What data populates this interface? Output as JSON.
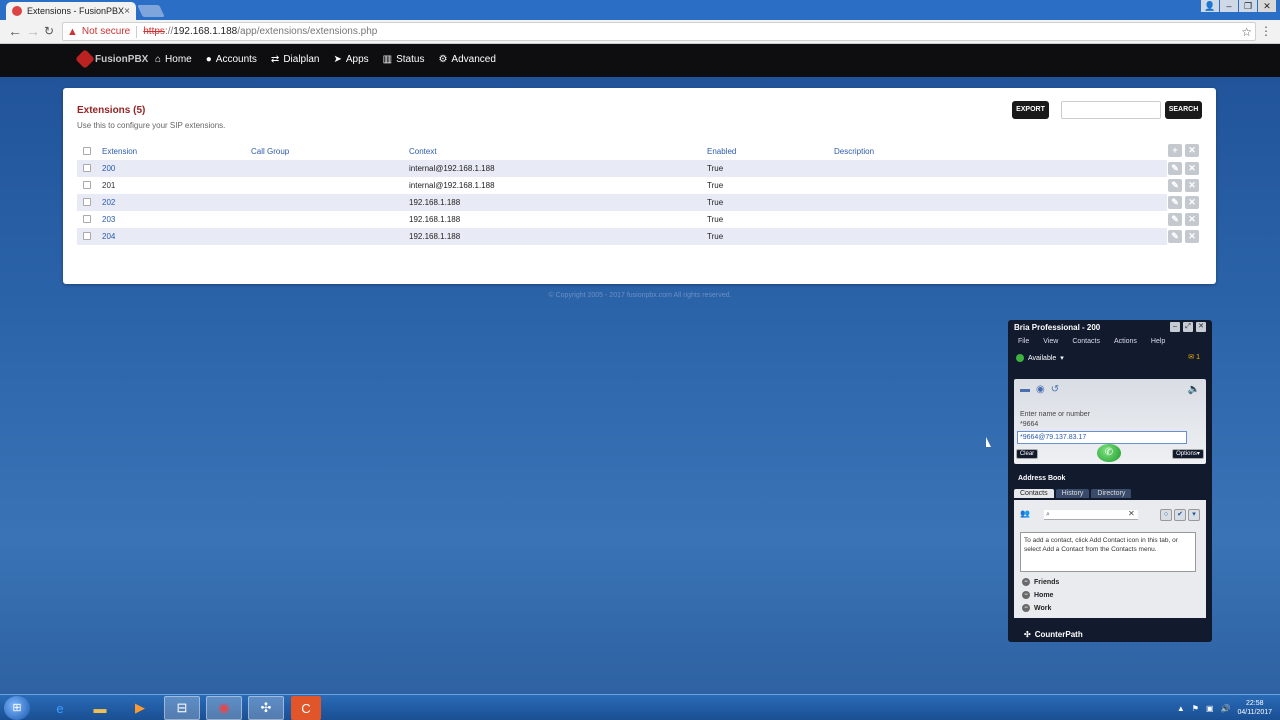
{
  "browser": {
    "tab_title": "Extensions - FusionPBX",
    "tab_close": "×",
    "not_secure": "Not secure",
    "url_scheme": "https",
    "url_sep": "://",
    "url_host": "192.168.1.188",
    "url_path": "/app/extensions/extensions.php"
  },
  "nav": {
    "logo_text": "FusionPBX",
    "items": [
      {
        "label": "Home",
        "icon": "home-icon"
      },
      {
        "label": "Accounts",
        "icon": "user-icon"
      },
      {
        "label": "Dialplan",
        "icon": "arrows-icon"
      },
      {
        "label": "Apps",
        "icon": "plane-icon"
      },
      {
        "label": "Status",
        "icon": "chart-icon"
      },
      {
        "label": "Advanced",
        "icon": "gear-icon"
      }
    ]
  },
  "page": {
    "title": "Extensions (5)",
    "subtitle": "Use this to configure your SIP extensions.",
    "export_label": "EXPORT",
    "search_label": "SEARCH",
    "search_value": "",
    "columns": [
      "Extension",
      "Call Group",
      "Context",
      "Enabled",
      "Description"
    ],
    "rows": [
      {
        "extension": "200",
        "call_group": "",
        "context": "internal@192.168.1.188",
        "enabled": "True",
        "description": ""
      },
      {
        "extension": "201",
        "call_group": "",
        "context": "internal@192.168.1.188",
        "enabled": "True",
        "description": ""
      },
      {
        "extension": "202",
        "call_group": "",
        "context": "192.168.1.188",
        "enabled": "True",
        "description": ""
      },
      {
        "extension": "203",
        "call_group": "",
        "context": "192.168.1.188",
        "enabled": "True",
        "description": ""
      },
      {
        "extension": "204",
        "call_group": "",
        "context": "192.168.1.188",
        "enabled": "True",
        "description": ""
      }
    ],
    "copyright": "© Copyright 2005 - 2017 fusionpbx.com All rights reserved."
  },
  "bria": {
    "title": "Bria Professional - 200",
    "menu": [
      "File",
      "View",
      "Contacts",
      "Actions",
      "Help"
    ],
    "status": "Available",
    "message_count": "1",
    "enter_label": "Enter name or number",
    "last_number": "*9664",
    "dial_value": "*9664@79.137.83.17",
    "clear_label": "Clear",
    "options_label": "Options",
    "address_book_title": "Address Book",
    "tabs": [
      "Contacts",
      "History",
      "Directory"
    ],
    "active_tab": "Contacts",
    "info_text": "To add a contact, click Add Contact icon in this tab, or select Add a Contact from the Contacts menu.",
    "groups": [
      "Friends",
      "Home",
      "Work"
    ],
    "brand": "CounterPath"
  },
  "taskbar": {
    "time": "22:58",
    "date": "04/11/2017"
  },
  "colors": {
    "accent_title": "#952424",
    "link": "#2c5bad",
    "nav_bg": "#0e0e10"
  }
}
